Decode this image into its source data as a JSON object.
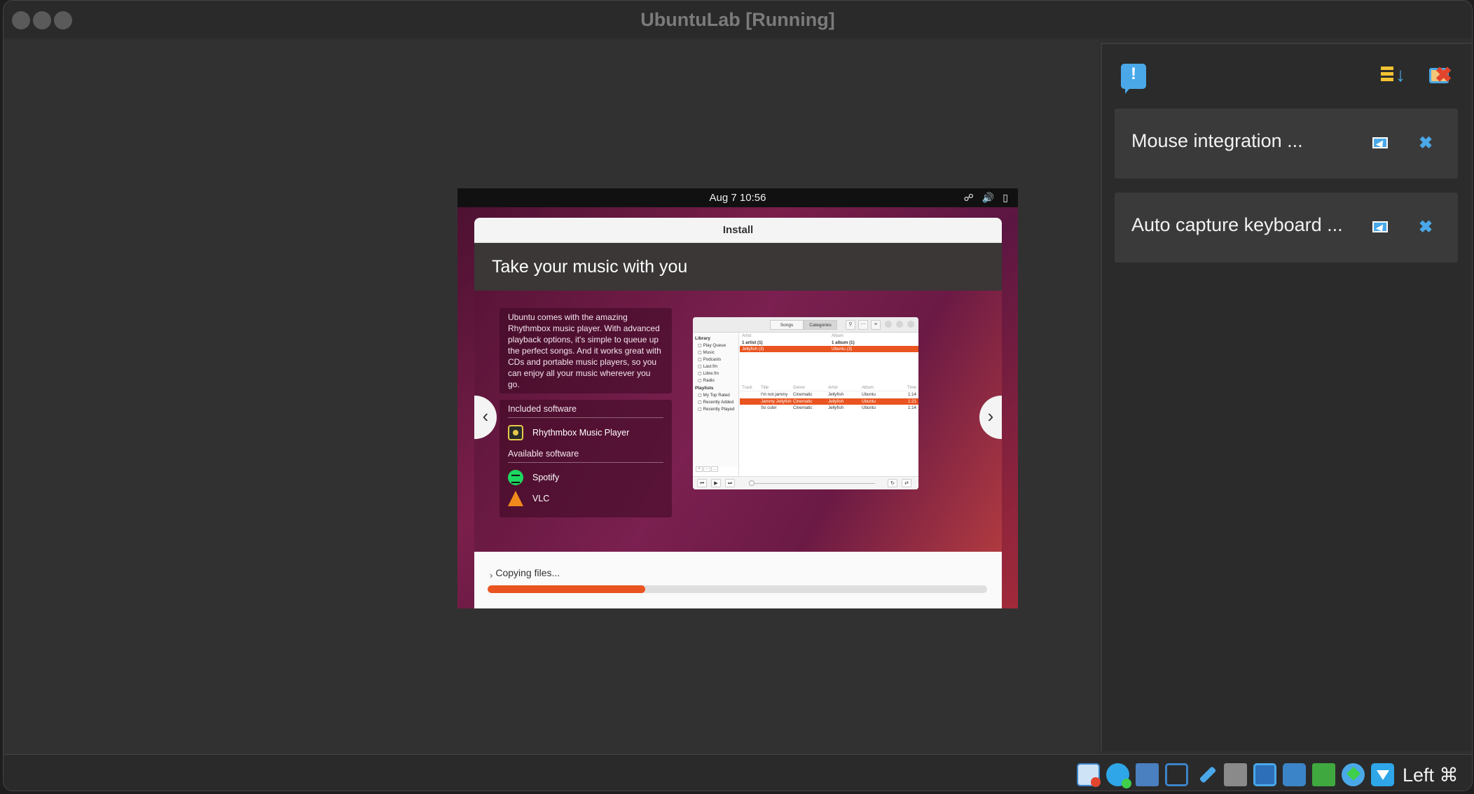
{
  "window": {
    "title": "UbuntuLab [Running]"
  },
  "guest": {
    "clock": "Aug 7  10:56",
    "tray_icons": [
      "network-icon",
      "volume-icon",
      "battery-icon"
    ],
    "installer": {
      "window_title": "Install",
      "slide_title": "Take your music with you",
      "description": "Ubuntu comes with the amazing Rhythmbox music player. With advanced playback options, it's simple to queue up the perfect songs. And it works great with CDs and portable music players, so you can enjoy all your music wherever you go.",
      "included_heading": "Included software",
      "included": [
        "Rhythmbox Music Player"
      ],
      "available_heading": "Available software",
      "available": [
        "Spotify",
        "VLC"
      ],
      "prev_label": "‹",
      "next_label": "›",
      "status": "Copying files...",
      "progress": 0.315,
      "accent_color": "#e95420",
      "rhythmbox": {
        "tabs": [
          "Songs",
          "Categories"
        ],
        "library_heading": "Library",
        "library": [
          "Play Queue",
          "Music",
          "Podcasts",
          "Last.fm",
          "Libre.fm",
          "Radio"
        ],
        "playlists_heading": "Playlists",
        "playlists": [
          "My Top Rated",
          "Recently Added",
          "Recently Played"
        ],
        "browser": {
          "artist_header": "Artist",
          "album_header": "Album",
          "artist_summary": "1 artist (1)",
          "album_summary": "1 album (1)",
          "artist_selected": "Jellyfish (3)",
          "album_selected": "Ubuntu (3)"
        },
        "track_columns": [
          "Track",
          "Title",
          "Genre",
          "Artist",
          "Album",
          "Time"
        ],
        "tracks": [
          {
            "title": "I'm not jammy",
            "genre": "Cinematic",
            "artist": "Jellyfish",
            "album": "Ubuntu",
            "time": "1:14"
          },
          {
            "title": "Jammy Jellyfish",
            "genre": "Cinematic",
            "artist": "Jellyfish",
            "album": "Ubuntu",
            "time": "1:21"
          },
          {
            "title": "So cute!",
            "genre": "Cinematic",
            "artist": "Jellyfish",
            "album": "Ubuntu",
            "time": "1:14"
          }
        ]
      }
    }
  },
  "notifications": [
    {
      "text": "Mouse integration ..."
    },
    {
      "text": "Auto capture keyboard ..."
    }
  ],
  "statusbar": {
    "icons": [
      "hard-disk-icon",
      "optical-drive-icon",
      "audio-icon",
      "display-icon",
      "usb-icon",
      "shared-folders-icon",
      "screen-icon",
      "recording-icon",
      "cpu-icon",
      "network-icon",
      "download-icon"
    ],
    "host_key": "Left ⌘"
  }
}
